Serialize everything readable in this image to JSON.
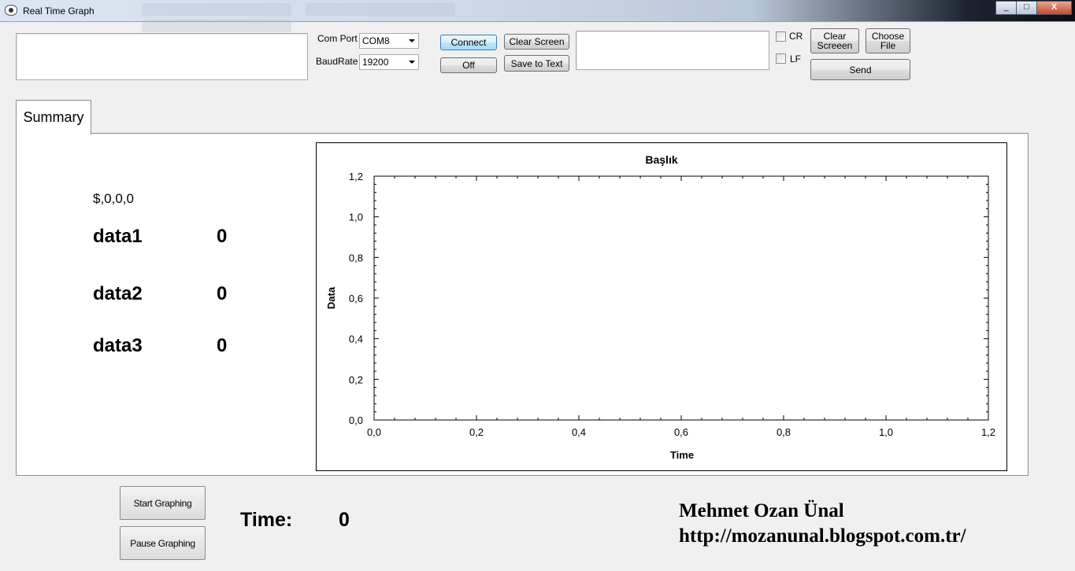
{
  "window": {
    "title": "Real Time Graph",
    "min": "_",
    "max": "□",
    "close": "X"
  },
  "connection": {
    "com_port_label": "Com Port",
    "com_port_value": "COM8",
    "baud_label": "BaudRate",
    "baud_value": "19200",
    "connect_label": "Connect",
    "off_label": "Off",
    "clear_screen_label": "Clear Screen",
    "save_to_text_label": "Save to Text"
  },
  "send_panel": {
    "cr_label": "CR",
    "lf_label": "LF",
    "clear_screeen_label": "Clear Screeen",
    "choose_file_label": "Choose File",
    "send_label": "Send"
  },
  "tabs": [
    {
      "label": "Summary"
    }
  ],
  "summary": {
    "raw_text": "$,0,0,0",
    "rows": [
      {
        "label": "data1",
        "value": "0"
      },
      {
        "label": "data2",
        "value": "0"
      },
      {
        "label": "data3",
        "value": "0"
      }
    ]
  },
  "chart_data": {
    "type": "line",
    "title": "Başlık",
    "xlabel": "Time",
    "ylabel": "Data",
    "xlim": [
      0,
      1.2
    ],
    "ylim": [
      0,
      1.2
    ],
    "xticks": [
      "0,0",
      "0,2",
      "0,4",
      "0,6",
      "0,8",
      "1,0",
      "1,2"
    ],
    "yticks": [
      "0,0",
      "0,2",
      "0,4",
      "0,6",
      "0,8",
      "1,0",
      "1,2"
    ],
    "series": [],
    "grid": false
  },
  "controls": {
    "start_label": "Start Graphing",
    "pause_label": "Pause Graphing",
    "time_label": "Time:",
    "time_value": "0"
  },
  "footer": {
    "author": "Mehmet Ozan Ünal",
    "url": "http://mozanunal.blogspot.com.tr/"
  }
}
